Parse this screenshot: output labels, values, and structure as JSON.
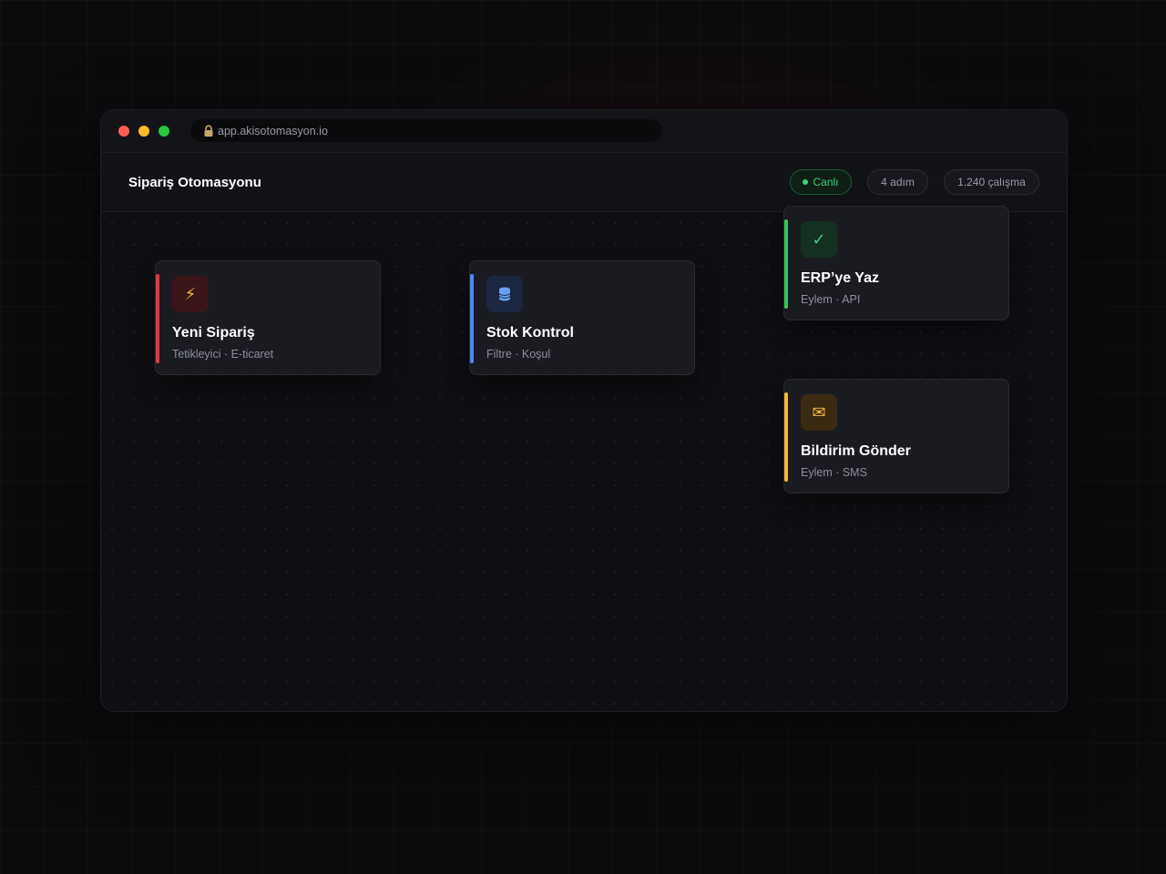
{
  "browser": {
    "url": "app.akisotomasyon.io",
    "lock_icon": "lock-icon"
  },
  "header": {
    "title": "Sipariş Otomasyonu",
    "status": "Canlı",
    "steps": "4 adım",
    "runs": "1.240 çalışma"
  },
  "colors": {
    "trigger": "#e0393e",
    "filter": "#4f86f7",
    "success": "#34c759",
    "warning": "#f5b73b",
    "live": "#3fd07a"
  },
  "nodes": [
    {
      "title": "Yeni Sipariş",
      "subtitle": "Tetikleyici · E-ticaret",
      "icon": "lightning-icon",
      "glyph": "⚡"
    },
    {
      "title": "Stok Kontrol",
      "subtitle": "Filtre · Koşul",
      "icon": "database-icon",
      "glyph": "⛁"
    },
    {
      "title": "ERP’ye Yaz",
      "subtitle": "Eylem · API",
      "icon": "check-icon",
      "glyph": "✓"
    },
    {
      "title": "Bildirim Gönder",
      "subtitle": "Eylem · SMS",
      "icon": "mail-icon",
      "glyph": "✉"
    }
  ],
  "connections": [
    {
      "from": "Yeni Sipariş",
      "to": "Stok Kontrol"
    },
    {
      "from": "Stok Kontrol",
      "to": "ERP’ye Yaz"
    },
    {
      "from": "Stok Kontrol",
      "to": "Bildirim Gönder"
    }
  ]
}
